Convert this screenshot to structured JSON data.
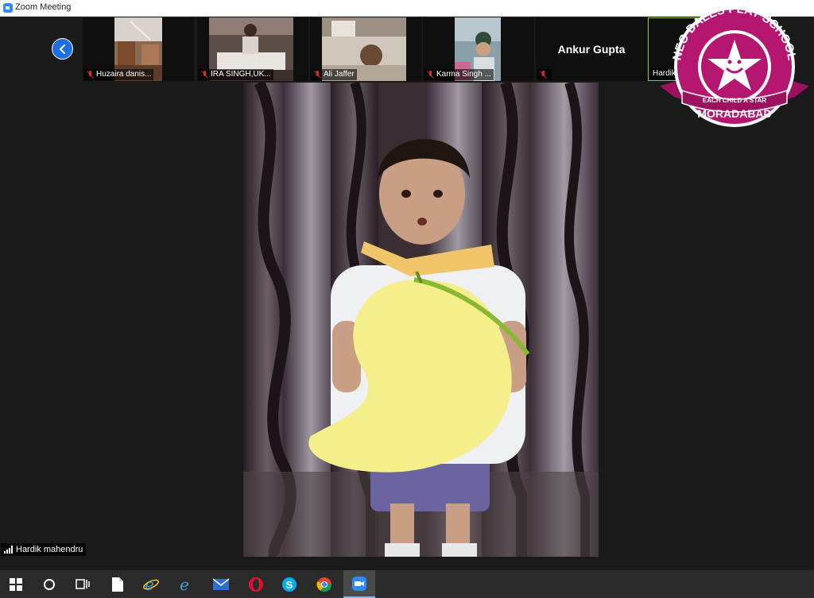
{
  "window": {
    "title": "Zoom Meeting"
  },
  "participants": [
    {
      "name": "Huzaira danis...",
      "muted": true
    },
    {
      "name": "IRA SINGH,UK...",
      "muted": true
    },
    {
      "name": "Ali Jaffer",
      "muted": true
    },
    {
      "name": "Karma Singh ...",
      "muted": true
    },
    {
      "name": "Ankur Gupta",
      "muted": true,
      "video_off": true
    },
    {
      "name": "Hardik",
      "muted": false,
      "active": true
    }
  ],
  "speaker": {
    "name": "Hardik mahendru"
  },
  "logo": {
    "top_text": "NEO DALES PLAY SCHOOL",
    "ribbon_text": "EACH CHILD A STAR",
    "bottom_text": "MORADABAD",
    "color": "#b5166f"
  },
  "taskbar": {
    "icons": [
      "windows-start-icon",
      "cortana-search-icon",
      "task-view-icon",
      "file-icon",
      "ie-icon",
      "edge-icon",
      "mail-icon",
      "opera-icon",
      "skype-icon",
      "chrome-icon",
      "zoom-icon"
    ]
  },
  "colors": {
    "zoom_blue": "#2d8cff",
    "mute_red": "#e02828",
    "active_border": "#8ac256"
  }
}
